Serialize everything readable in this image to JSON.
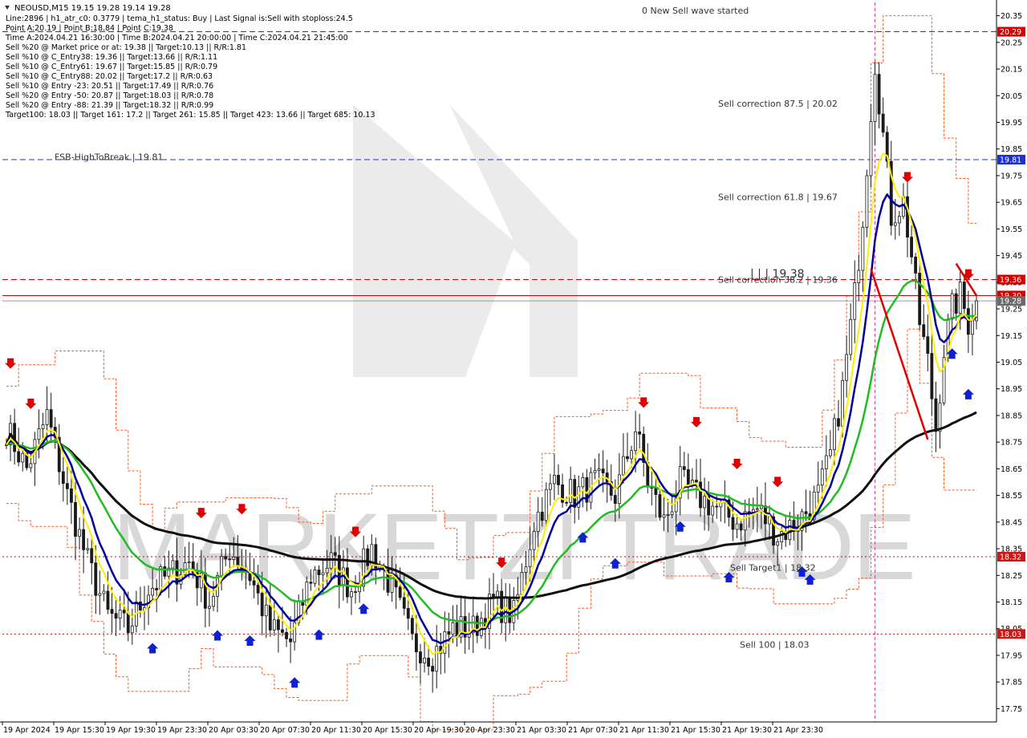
{
  "header": {
    "symbol_line": "NEOUSD,M15  19.15 19.28 19.14 19.28",
    "info_lines": [
      "Line:2896 | h1_atr_c0: 0.3779 | tema_h1_status: Buy | Last Signal is:Sell with stoploss:24.5",
      "Point A:20.19 | Point B:18.84 | Point C:19.38",
      "Time A:2024.04.21 16:30:00 | Time B:2024.04.21 20:00:00 | Time C:2024.04.21 21:45:00",
      "Sell %20 @ Market price or at: 19.38 || Target:10.13 || R/R:1.81",
      "Sell %10 @ C_Entry38: 19.36 || Target:13.66 || R/R:1.11",
      "Sell %10 @ C_Entry61: 19.67 || Target:15.85 || R/R:0.79",
      "Sell %10 @ C_Entry88: 20.02 || Target:17.2 || R/R:0.63",
      "Sell %10 @ Entry -23: 20.51 || Target:17.49 || R/R:0.76",
      "Sell %20 @ Entry -50: 20.87 || Target:18.03 || R/R:0.78",
      "Sell %20 @ Entry -88: 21.39 || Target:18.32 || R/R:0.99",
      "Target100: 18.03 || Target 161: 17.2 || Target 261: 15.85 || Target 423: 13.66 || Target 685: 10.13"
    ]
  },
  "watermark": "MARKETZI TRADE",
  "chart_data": {
    "type": "candlestick",
    "ylim": [
      17.7,
      20.4
    ],
    "y_ticks": [
      "20.35",
      "20.25",
      "20.15",
      "20.05",
      "19.95",
      "19.85",
      "19.75",
      "19.65",
      "19.55",
      "19.45",
      "19.35",
      "19.25",
      "19.15",
      "19.05",
      "18.95",
      "18.85",
      "18.75",
      "18.65",
      "18.55",
      "18.45",
      "18.35",
      "18.25",
      "18.15",
      "18.05",
      "17.95",
      "17.85",
      "17.75"
    ],
    "x_ticks": [
      "19 Apr 2024",
      "19 Apr 15:30",
      "19 Apr 19:30",
      "19 Apr 23:30",
      "20 Apr 03:30",
      "20 Apr 07:30",
      "20 Apr 11:30",
      "20 Apr 15:30",
      "20 Apr 19:30",
      "20 Apr 23:30",
      "21 Apr 03:30",
      "21 Apr 07:30",
      "21 Apr 11:30",
      "21 Apr 15:30",
      "21 Apr 19:30",
      "21 Apr 23:30"
    ],
    "candle_count": 240,
    "close_path": [
      [
        0,
        18.8
      ],
      [
        5,
        18.65
      ],
      [
        10,
        18.85
      ],
      [
        15,
        18.55
      ],
      [
        20,
        18.3
      ],
      [
        25,
        18.1
      ],
      [
        30,
        18.05
      ],
      [
        35,
        18.2
      ],
      [
        40,
        18.25
      ],
      [
        45,
        18.3
      ],
      [
        50,
        18.15
      ],
      [
        55,
        18.35
      ],
      [
        60,
        18.25
      ],
      [
        65,
        18.05
      ],
      [
        70,
        18.0
      ],
      [
        75,
        18.25
      ],
      [
        80,
        18.3
      ],
      [
        85,
        18.2
      ],
      [
        90,
        18.35
      ],
      [
        95,
        18.2
      ],
      [
        100,
        18.0
      ],
      [
        105,
        17.95
      ],
      [
        110,
        18.05
      ],
      [
        115,
        18.05
      ],
      [
        120,
        18.15
      ],
      [
        125,
        18.1
      ],
      [
        130,
        18.45
      ],
      [
        135,
        18.6
      ],
      [
        140,
        18.55
      ],
      [
        145,
        18.6
      ],
      [
        150,
        18.55
      ],
      [
        155,
        18.8
      ],
      [
        158,
        18.6
      ],
      [
        162,
        18.45
      ],
      [
        166,
        18.6
      ],
      [
        170,
        18.55
      ],
      [
        175,
        18.5
      ],
      [
        180,
        18.45
      ],
      [
        185,
        18.5
      ],
      [
        190,
        18.4
      ],
      [
        195,
        18.45
      ],
      [
        200,
        18.55
      ],
      [
        203,
        18.7
      ],
      [
        206,
        18.95
      ],
      [
        209,
        19.3
      ],
      [
        211,
        19.6
      ],
      [
        213,
        20.0
      ],
      [
        214,
        20.18
      ],
      [
        216,
        19.9
      ],
      [
        218,
        19.6
      ],
      [
        221,
        19.65
      ],
      [
        223,
        19.45
      ],
      [
        225,
        19.2
      ],
      [
        227,
        19.05
      ],
      [
        229,
        18.8
      ],
      [
        231,
        19.1
      ],
      [
        233,
        19.25
      ],
      [
        235,
        19.3
      ],
      [
        237,
        19.2
      ],
      [
        239,
        19.28
      ]
    ],
    "levels": [
      {
        "name": "20.29",
        "value": 20.29,
        "color": "#d40000",
        "style": "dash"
      },
      {
        "name": "FSB-HighToBreak | 19.81",
        "value": 19.81,
        "color": "#2030d0",
        "style": "dash"
      },
      {
        "name": "19.36",
        "value": 19.36,
        "color": "#d40000",
        "style": "dash"
      },
      {
        "name": "19.30",
        "value": 19.3,
        "color": "#d40000",
        "style": "solid"
      },
      {
        "name": "19.28",
        "value": 19.28,
        "color": "#9a9a9a",
        "style": "solid"
      },
      {
        "name": "Sell Target1 | 18.32",
        "value": 18.32,
        "color": "#b01010",
        "style": "dot"
      },
      {
        "name": "Sell 100 | 18.03",
        "value": 18.03,
        "color": "#b01010",
        "style": "dot"
      }
    ],
    "annotations": [
      {
        "text": "0 New Sell wave started",
        "value": 20.37
      },
      {
        "text": "Sell correction 87.5 | 20.02",
        "value": 20.02
      },
      {
        "text": "Sell correction 61.8 | 19.67",
        "value": 19.67
      },
      {
        "text": "| | | 19.38",
        "value": 19.38
      },
      {
        "text": "Sell correction 38.2 | 19.36",
        "value": 19.36
      },
      {
        "text": "Sell Target1 | 18.32",
        "value": 18.28
      },
      {
        "text": "Sell 100 | 18.03",
        "value": 17.99
      },
      {
        "text": "FSB-HighToBreak | 19.81",
        "value": 19.82
      }
    ],
    "price_labels": [
      {
        "text": "20.29",
        "value": 20.29,
        "bg": "#d40000"
      },
      {
        "text": "19.81",
        "value": 19.81,
        "bg": "#2030d0"
      },
      {
        "text": "19.36",
        "value": 19.36,
        "bg": "#d40000"
      },
      {
        "text": "19.30",
        "value": 19.3,
        "bg": "#d40000"
      },
      {
        "text": "19.28",
        "value": 19.28,
        "bg": "#6a6a6a"
      },
      {
        "text": "18.32",
        "value": 18.32,
        "bg": "#c81818"
      },
      {
        "text": "18.03",
        "value": 18.03,
        "bg": "#c81818"
      }
    ],
    "series": [
      {
        "name": "",
        "color": "#101010"
      },
      {
        "name": "",
        "color": "#22bb22"
      },
      {
        "name": "",
        "color": "#000099"
      },
      {
        "name": "",
        "color": "#ffee00"
      }
    ],
    "colors": {
      "bull": "#1a1a1a",
      "bear": "#1a1a1a",
      "envelope": "#ff5a1f",
      "axis": "#000000"
    }
  }
}
